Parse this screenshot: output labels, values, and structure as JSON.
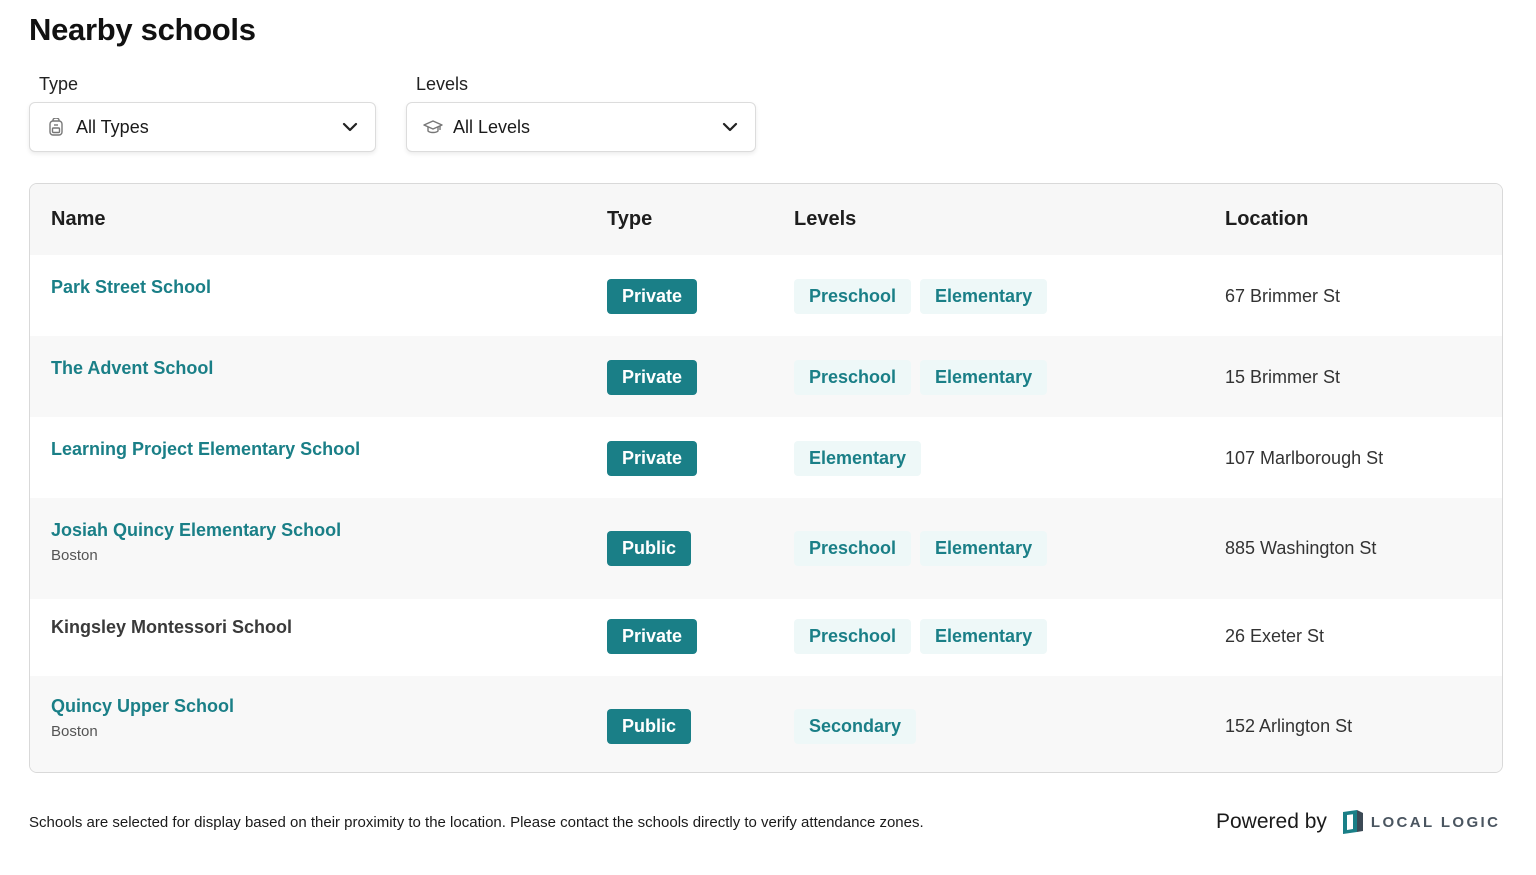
{
  "page": {
    "title": "Nearby schools"
  },
  "filters": {
    "type": {
      "label": "Type",
      "value": "All Types",
      "icon": "backpack-icon"
    },
    "levels": {
      "label": "Levels",
      "value": "All Levels",
      "icon": "graduation-cap-icon"
    }
  },
  "table": {
    "headers": {
      "name": "Name",
      "type": "Type",
      "levels": "Levels",
      "location": "Location"
    },
    "rows": [
      {
        "name": "Park Street School",
        "city": "",
        "type": "Private",
        "levels": [
          "Preschool",
          "Elementary"
        ],
        "location": "67 Brimmer St",
        "link": true
      },
      {
        "name": "The Advent School",
        "city": "",
        "type": "Private",
        "levels": [
          "Preschool",
          "Elementary"
        ],
        "location": "15 Brimmer St",
        "link": true
      },
      {
        "name": "Learning Project Elementary School",
        "city": "",
        "type": "Private",
        "levels": [
          "Elementary"
        ],
        "location": "107 Marlborough St",
        "link": true
      },
      {
        "name": "Josiah Quincy Elementary School",
        "city": "Boston",
        "type": "Public",
        "levels": [
          "Preschool",
          "Elementary"
        ],
        "location": "885 Washington St",
        "link": true
      },
      {
        "name": "Kingsley Montessori School",
        "city": "",
        "type": "Private",
        "levels": [
          "Preschool",
          "Elementary"
        ],
        "location": "26 Exeter St",
        "link": false
      },
      {
        "name": "Quincy Upper School",
        "city": "Boston",
        "type": "Public",
        "levels": [
          "Secondary"
        ],
        "location": "152 Arlington St",
        "link": true
      }
    ]
  },
  "footer": {
    "note": "Schools are selected for display based on their proximity to the location. Please contact the schools directly to verify attendance zones.",
    "powered_by": "Powered by",
    "brand": "LOCAL LOGIC"
  },
  "colors": {
    "accent": "#1a7f87",
    "tag_bg": "#eef8f8",
    "header_bg": "#f7f7f7"
  }
}
